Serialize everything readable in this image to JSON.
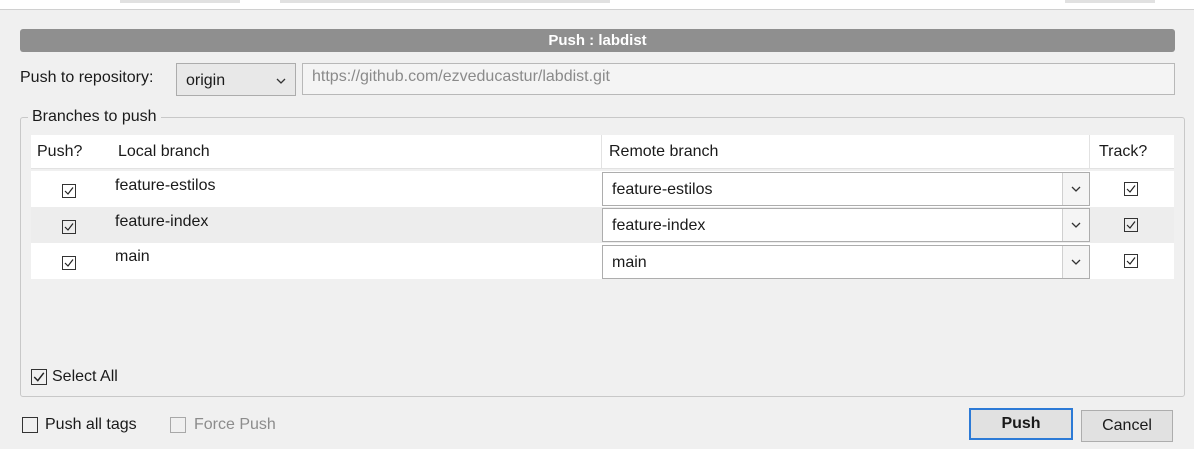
{
  "dialog": {
    "title": "Push : labdist"
  },
  "repository": {
    "label": "Push to repository:",
    "selected": "origin",
    "url": "https://github.com/ezveducastur/labdist.git"
  },
  "branches": {
    "group_title": "Branches to push",
    "columns": {
      "push": "Push?",
      "local": "Local branch",
      "remote": "Remote branch",
      "track": "Track?"
    },
    "rows": [
      {
        "local": "feature-estilos",
        "remote": "feature-estilos",
        "push": true,
        "track": true
      },
      {
        "local": "feature-index",
        "remote": "feature-index",
        "push": true,
        "track": true
      },
      {
        "local": "main",
        "remote": "main",
        "push": true,
        "track": true
      }
    ],
    "select_all": {
      "label": "Select All",
      "checked": true
    }
  },
  "options": {
    "push_all_tags": {
      "label": "Push all tags",
      "checked": false
    },
    "force_push": {
      "label": "Force Push",
      "checked": false,
      "enabled": false
    }
  },
  "buttons": {
    "push": "Push",
    "cancel": "Cancel"
  },
  "colors": {
    "title_bar": "#8f8f8f",
    "default_button_border": "#2c7ad6",
    "dialog_background": "#f0f0f0"
  },
  "icons": {
    "dropdown": "chevron-down-icon",
    "check": "checkmark-icon"
  }
}
